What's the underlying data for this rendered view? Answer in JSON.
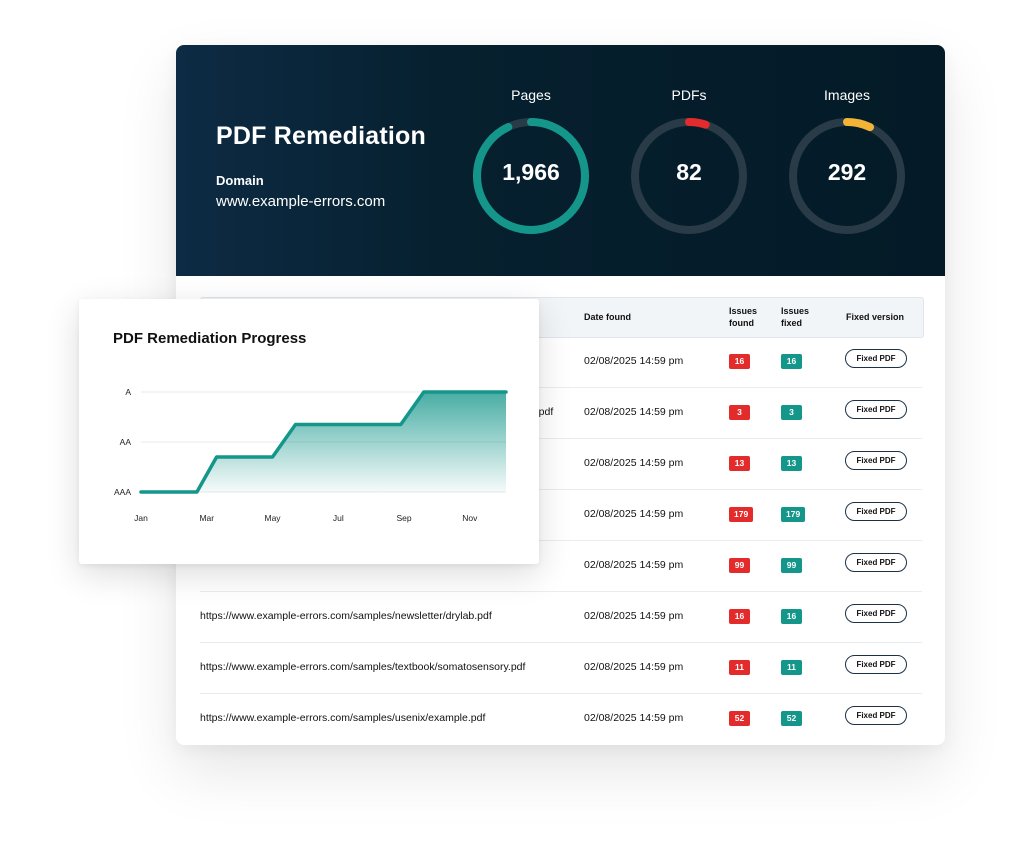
{
  "header": {
    "title": "PDF Remediation",
    "domain_label": "Domain",
    "domain_value": "www.example-errors.com"
  },
  "stats": [
    {
      "label": "Pages",
      "value": "1,966",
      "color": "#14968a",
      "progress": 0.93
    },
    {
      "label": "PDFs",
      "value": "82",
      "color": "#e42b2b",
      "progress": 0.05
    },
    {
      "label": "Images",
      "value": "292",
      "color": "#f2b437",
      "progress": 0.07
    }
  ],
  "colors": {
    "header_bg": "#041a27",
    "gauge_track": "#283b46",
    "found": "#e42b2b",
    "fixed": "#14968a",
    "line": "#14968a"
  },
  "table": {
    "headers": {
      "date": "Date found",
      "issues_found": "Issues found",
      "issues_fixed": "Issues fixed",
      "fixed_version": "Fixed version"
    },
    "rows": [
      {
        "url": "",
        "date": "02/08/2025 14:59 pm",
        "found": "16",
        "fixed": "16",
        "action": "Fixed PDF"
      },
      {
        "url": "mple.pdf",
        "date": "02/08/2025 14:59 pm",
        "found": "3",
        "fixed": "3",
        "action": "Fixed PDF"
      },
      {
        "url": "",
        "date": "02/08/2025 14:59 pm",
        "found": "13",
        "fixed": "13",
        "action": "Fixed PDF"
      },
      {
        "url": "",
        "date": "02/08/2025 14:59 pm",
        "found": "179",
        "fixed": "179",
        "action": "Fixed PDF"
      },
      {
        "url": "",
        "date": "02/08/2025 14:59 pm",
        "found": "99",
        "fixed": "99",
        "action": "Fixed PDF"
      },
      {
        "url": "https://www.example-errors.com/samples/newsletter/drylab.pdf",
        "date": "02/08/2025 14:59 pm",
        "found": "16",
        "fixed": "16",
        "action": "Fixed PDF"
      },
      {
        "url": "https://www.example-errors.com/samples/textbook/somatosensory.pdf",
        "date": "02/08/2025 14:59 pm",
        "found": "11",
        "fixed": "11",
        "action": "Fixed PDF"
      },
      {
        "url": "https://www.example-errors.com/samples/usenix/example.pdf",
        "date": "02/08/2025 14:59 pm",
        "found": "52",
        "fixed": "52",
        "action": "Fixed PDF"
      }
    ]
  },
  "chart_data": {
    "type": "line",
    "title": "PDF Remediation Progress",
    "x_labels": [
      "Jan",
      "Mar",
      "May",
      "Jul",
      "Sep",
      "Nov"
    ],
    "y_labels": [
      "AAA",
      "AA",
      "A"
    ],
    "x": [
      "Jan",
      "Mar",
      "Apr",
      "May",
      "Jun",
      "Jul",
      "Sep",
      "Oct",
      "Nov",
      "Dec"
    ],
    "y": [
      "AAA",
      "AAA",
      "AA",
      "AA",
      "AA",
      "A",
      "A",
      "A",
      "A",
      "A"
    ],
    "y_numeric": [
      0,
      0,
      0.7,
      0.7,
      1.35,
      1.35,
      1.35,
      2,
      2,
      2
    ],
    "x_month_index": [
      0,
      1.7,
      2.3,
      4,
      4.7,
      6.6,
      7.9,
      8.6,
      10,
      11.1
    ],
    "grid": true,
    "area_fill": true,
    "legend": "none"
  }
}
